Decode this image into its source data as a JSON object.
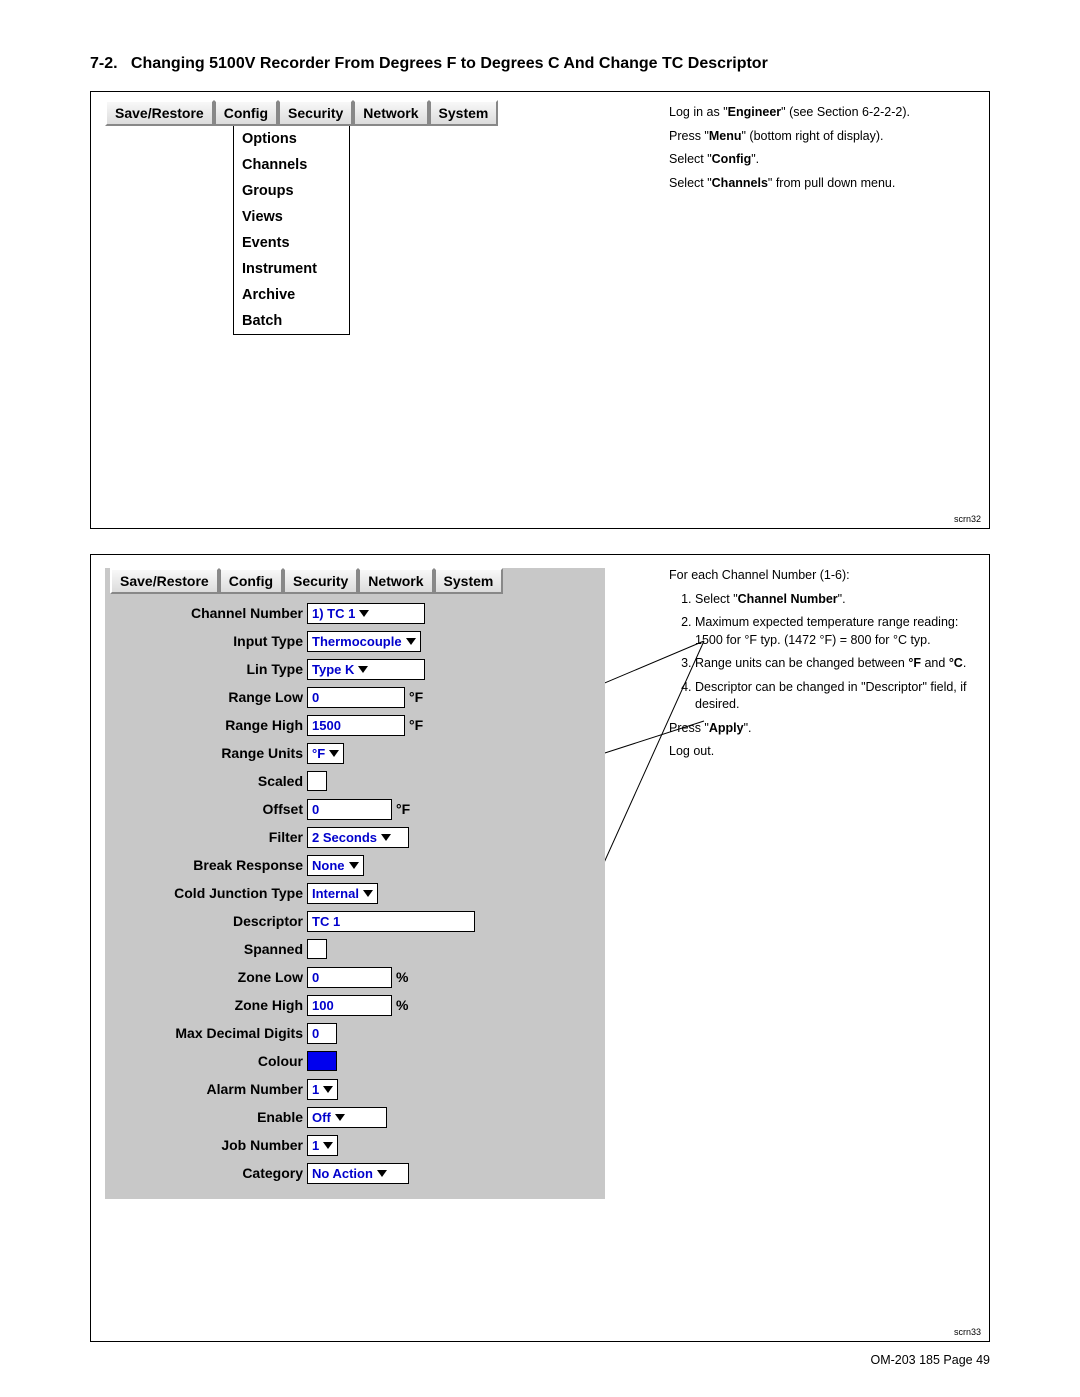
{
  "title_prefix": "7-2.",
  "title": "Changing 5100V Recorder From Degrees F to Degrees C And Change TC Descriptor",
  "tabs": [
    "Save/Restore",
    "Config",
    "Security",
    "Network",
    "System"
  ],
  "config_menu": [
    "Options",
    "Channels",
    "Groups",
    "Views",
    "Events",
    "Instrument",
    "Archive",
    "Batch"
  ],
  "instr1": {
    "login_a": "Log in as \"",
    "login_b": "Engineer",
    "login_c": "\" (see Section 6-2-2-2).",
    "menu_a": "Press \"",
    "menu_b": "Menu",
    "menu_c": "\" (bottom right of display).",
    "config_a": "Select \"",
    "config_b": "Config",
    "config_c": "\".",
    "channels_a": "Select \"",
    "channels_b": "Channels",
    "channels_c": "\" from pull down menu."
  },
  "tag1": "scrn32",
  "instr2": {
    "foreach": "For each Channel Number (1-6):",
    "li1_a": "Select \"",
    "li1_b": "Channel Number",
    "li1_c": "\".",
    "li2": "Maximum expected temperature range reading: 1500 for °F typ. (1472 °F) = 800 for °C typ.",
    "li3_a": "Range units can be changed between ",
    "li3_b": "°F",
    "li3_c": " and ",
    "li3_d": "°C",
    "li3_e": ".",
    "li4": "Descriptor can be changed in \"Descriptor\" field, if desired.",
    "apply_a": "Press \"",
    "apply_b": "Apply",
    "apply_c": "\".",
    "logout": "Log out."
  },
  "tag2": "scrn33",
  "form": {
    "channel_number_label": "Channel Number",
    "channel_number_value": "1) TC 1",
    "input_type_label": "Input Type",
    "input_type_value": "Thermocouple",
    "lin_type_label": "Lin Type",
    "lin_type_value": "Type K",
    "range_low_label": "Range Low",
    "range_low_value": "0",
    "range_low_unit": "°F",
    "range_high_label": "Range High",
    "range_high_value": "1500",
    "range_high_unit": "°F",
    "range_units_label": "Range Units",
    "range_units_value": "°F",
    "scaled_label": "Scaled",
    "offset_label": "Offset",
    "offset_value": "0",
    "offset_unit": "°F",
    "filter_label": "Filter",
    "filter_value": "2 Seconds",
    "break_response_label": "Break Response",
    "break_response_value": "None",
    "cjt_label": "Cold Junction Type",
    "cjt_value": "Internal",
    "descriptor_label": "Descriptor",
    "descriptor_value": "TC 1",
    "spanned_label": "Spanned",
    "zone_low_label": "Zone Low",
    "zone_low_value": "0",
    "zone_low_unit": "%",
    "zone_high_label": "Zone High",
    "zone_high_value": "100",
    "zone_high_unit": "%",
    "max_dec_label": "Max Decimal Digits",
    "max_dec_value": "0",
    "colour_label": "Colour",
    "alarm_number_label": "Alarm Number",
    "alarm_number_value": "1",
    "enable_label": "Enable",
    "enable_value": "Off",
    "job_number_label": "Job Number",
    "job_number_value": "1",
    "category_label": "Category",
    "category_value": "No Action"
  },
  "footer": "OM-203 185 Page 49"
}
